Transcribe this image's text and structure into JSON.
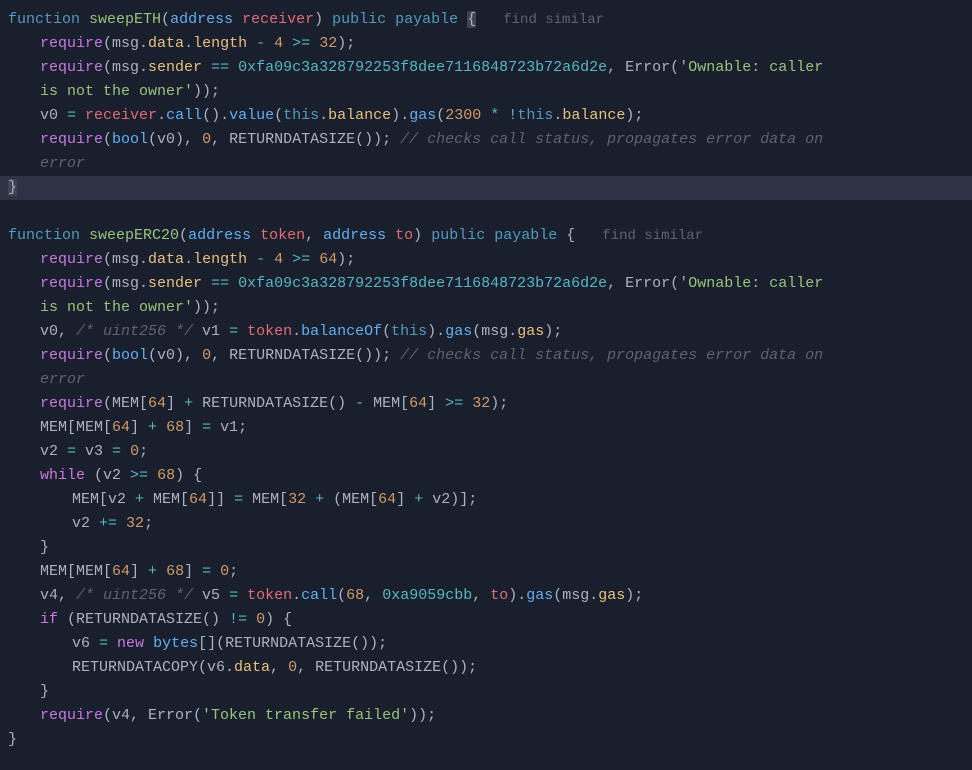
{
  "func1": {
    "keyword": "function",
    "name": "sweepETH",
    "param_type": "address",
    "param_name": "receiver",
    "vis": "public",
    "mut": "payable",
    "find_similar": "find similar",
    "lines": {
      "l1_require": "require",
      "l1_rest": "(msg.data.length - 4 >= 32);",
      "l2_require": "require",
      "l2a": "(msg.sender == ",
      "l2_addr": "0xfa09c3a328792253f8dee7116848723b72a6d2e",
      "l2b": ", Error(",
      "l2_str1": "'Ownable: caller",
      "l3a": "is not the owner'",
      "l3b": "));",
      "l4a": "v0 = receiver.call().value(",
      "l4_this": "this",
      "l4b": ".balance).gas(2300 * !",
      "l4c": ".balance);",
      "l5_require": "require",
      "l5a": "(",
      "l5_bool": "bool",
      "l5b": "(v0), 0, RETURNDATASIZE()); ",
      "l5_comment": "// checks call status, propagates error data on",
      "l6_comment": "error"
    }
  },
  "func2": {
    "keyword": "function",
    "name": "sweepERC20",
    "p1_type": "address",
    "p1_name": "token",
    "p2_type": "address",
    "p2_name": "to",
    "vis": "public",
    "mut": "payable",
    "find_similar": "find similar",
    "lines": {
      "l1_require": "require",
      "l1_rest": "(msg.data.length - 4 >= 64);",
      "l2_require": "require",
      "l2a": "(msg.sender == ",
      "l2_addr": "0xfa09c3a328792253f8dee7116848723b72a6d2e",
      "l2b": ", Error(",
      "l2_str1": "'Ownable: caller",
      "l3a": "is not the owner'",
      "l3b": "));",
      "l4a": "v0, ",
      "l4_comment": "/* uint256 */",
      "l4b": " v1 = token.balanceOf(",
      "l4_this": "this",
      "l4c": ").gas(msg.gas);",
      "l5_require": "require",
      "l5a": "(",
      "l5_bool": "bool",
      "l5b": "(v0), 0, RETURNDATASIZE()); ",
      "l5_comment": "// checks call status, propagates error data on",
      "l6_comment": "error",
      "l7_require": "require",
      "l7_rest": "(MEM[64] + RETURNDATASIZE() - MEM[64] >= 32);",
      "l8": "MEM[MEM[64] + 68] = v1;",
      "l9": "v2 = v3 = 0;",
      "l10_while": "while",
      "l10_rest": " (v2 >= 68) {",
      "l11": "MEM[v2 + MEM[64]] = MEM[32 + (MEM[64] + v2)];",
      "l12": "v2 += 32;",
      "l13": "}",
      "l14": "MEM[MEM[64] + 68] = 0;",
      "l15a": "v4, ",
      "l15_comment": "/* uint256 */",
      "l15b": " v5 = token.call(68, ",
      "l15_hex": "0xa9059cbb",
      "l15c": ", to).gas(msg.gas);",
      "l16_if": "if",
      "l16_rest": " (RETURNDATASIZE() != 0) {",
      "l17a": "v6 = ",
      "l17_new": "new",
      "l17b": " ",
      "l17_bytes": "bytes",
      "l17c": "[](RETURNDATASIZE());",
      "l18": "RETURNDATACOPY(v6.data, 0, RETURNDATASIZE());",
      "l19": "}",
      "l20_require": "require",
      "l20a": "(v4, Error(",
      "l20_str": "'Token transfer failed'",
      "l20b": "));"
    }
  },
  "end_brace": "}"
}
